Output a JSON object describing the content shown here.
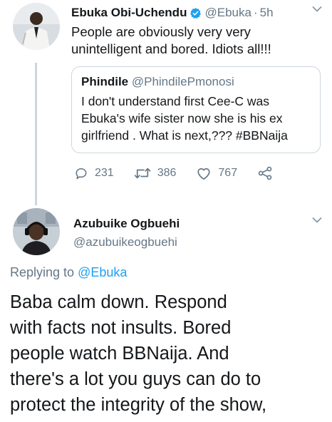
{
  "tweet": {
    "author_name": "Ebuka Obi-Uchendu",
    "author_handle": "@Ebuka",
    "separator": "·",
    "time": "5h",
    "text_line1": "People are obviously very very",
    "text_line2": "unintelligent and bored. Idiots all!!!",
    "quote": {
      "author_name": "Phindile",
      "author_handle": "@PhindilePmonosi",
      "text_line1": "I don't understand first Cee-C was",
      "text_line2": "Ebuka's wife sister now she is his ex",
      "text_line3": "girlfriend . What is next,??? #BBNaija"
    },
    "actions": {
      "reply_count": "231",
      "retweet_count": "386",
      "like_count": "767"
    }
  },
  "reply": {
    "author_name": "Azubuike Ogbuehi",
    "author_handle": "@azubuikeogbuehi",
    "replying_prefix": "Replying to",
    "replying_mention": "@Ebuka",
    "text_line1": "Baba calm down. Respond",
    "text_line2": "with facts not insults. Bored",
    "text_line3": "people watch BBNaija. And",
    "text_line4": "there's a lot you guys can do to",
    "text_line5": "protect the integrity of the show,"
  },
  "icons": {
    "verified": "verified-badge-icon",
    "chevron": "chevron-down-icon",
    "reply": "reply-icon",
    "retweet": "retweet-icon",
    "like": "heart-icon",
    "share": "share-icon"
  },
  "colors": {
    "accent": "#1da1f2",
    "secondary_text": "#657786",
    "primary_text": "#14171a",
    "border": "#ccd6dd"
  }
}
